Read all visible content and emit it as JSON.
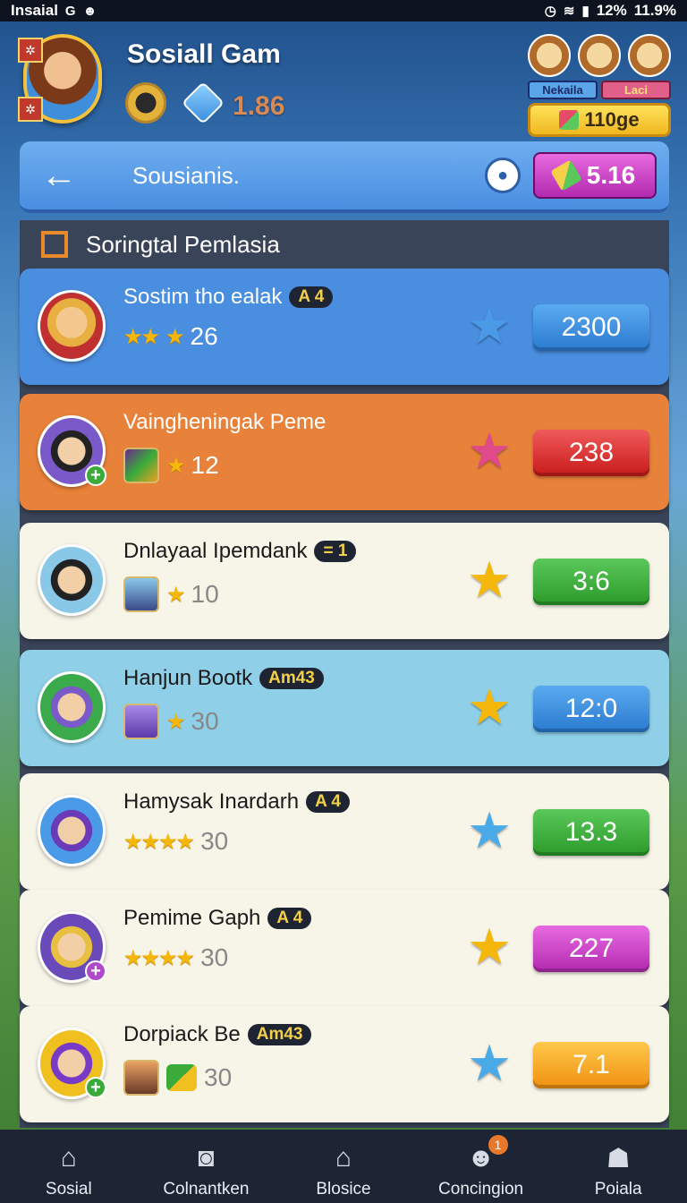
{
  "status_bar": {
    "carrier": "Insaial",
    "battery": "12%",
    "time": "11.9%"
  },
  "header": {
    "title": "Sosiall Gam",
    "balance": "1.86",
    "promo_tag_1": "Nekaila",
    "promo_tag_2": "Laci",
    "promo_button": "110ge"
  },
  "navbar": {
    "title": "Sousianis.",
    "pill_value": "5.16"
  },
  "section": {
    "title": "Soringtal Pemlasia"
  },
  "rows": [
    {
      "name": "Sostim tho ealak",
      "badge": "A 4",
      "stars": "★★",
      "value": "26",
      "score": "2300"
    },
    {
      "name": "Vaingheningak Peme",
      "badge": "",
      "stars": "",
      "value": "12",
      "score": "238"
    },
    {
      "name": "Dnlayaal Ipemdank",
      "badge": "= 1",
      "stars": "",
      "value": "10",
      "score": "3:6"
    },
    {
      "name": "Hanjun Bootk",
      "badge": "Am43",
      "stars": "",
      "value": "30",
      "score": "12:0"
    },
    {
      "name": "Hamysak Inardarh",
      "badge": "A 4",
      "stars": "★★★★",
      "value": "30",
      "score": "13.3"
    },
    {
      "name": "Pemime Gaph",
      "badge": "A 4",
      "stars": "★★★★",
      "value": "30",
      "score": "227"
    },
    {
      "name": "Dorpiack Be",
      "badge": "Am43",
      "stars": "",
      "value": "30",
      "score": "7.1"
    }
  ],
  "bottom_nav": [
    {
      "label": "Sosial",
      "icon": "home-icon"
    },
    {
      "label": "Colnantken",
      "icon": "square-icon"
    },
    {
      "label": "Blosice",
      "icon": "house-icon"
    },
    {
      "label": "Concingion",
      "icon": "chat-icon",
      "count": "1"
    },
    {
      "label": "Poiala",
      "icon": "robot-icon"
    }
  ],
  "colors": {
    "row1_bg": "#4a8ee0",
    "row2_bg": "#e8823a",
    "row_light_bg": "#f7f4e8",
    "row_cyan_bg": "#8fd0e8",
    "score_blue": "#3a8fe0",
    "score_red": "#e03030",
    "score_green": "#3aaa3a",
    "score_purple": "#c850c8",
    "score_orange": "#f0a020"
  }
}
